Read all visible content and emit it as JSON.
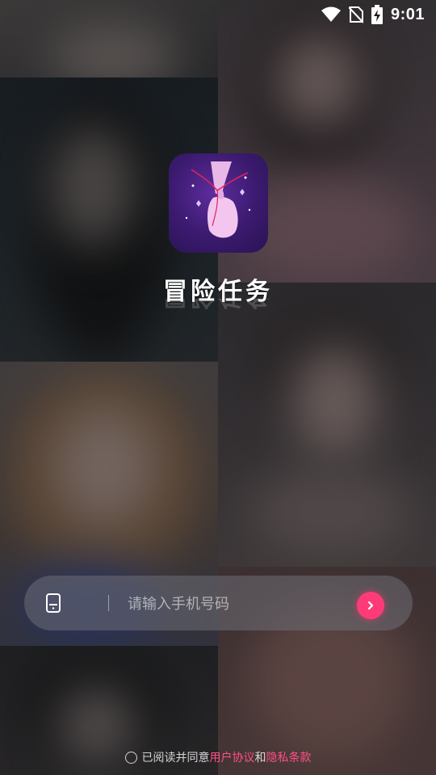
{
  "status_bar": {
    "time": "9:01",
    "icons": [
      "wifi-icon",
      "no-sim-icon",
      "battery-charging-icon"
    ]
  },
  "app": {
    "name": "冒险任务",
    "logo_icon": "pinky-promise-hands-icon",
    "accent_color": "#fe3b78"
  },
  "login": {
    "phone_placeholder": "请输入手机号码",
    "phone_value": "",
    "phone_icon": "mobile-phone-icon",
    "submit_icon": "chevron-right-icon"
  },
  "agreement": {
    "prefix": "已阅读并同意",
    "user_agreement": "用户协议",
    "and": "和",
    "privacy_policy": "隐私条款"
  }
}
